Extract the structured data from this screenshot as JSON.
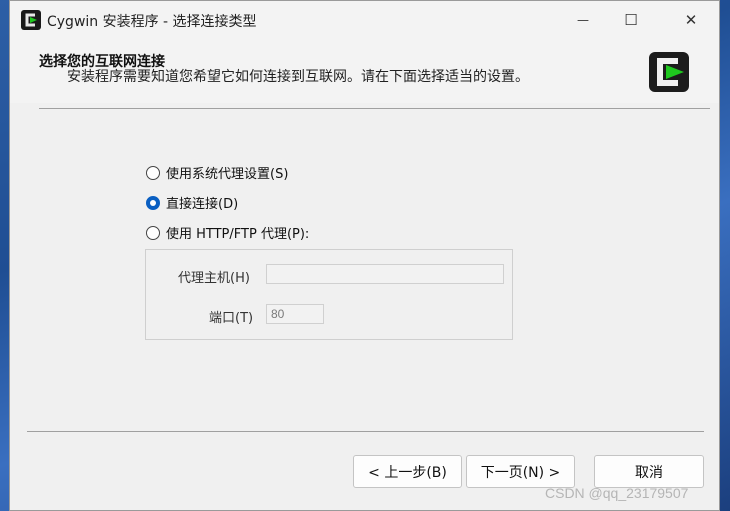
{
  "window": {
    "title": "Cygwin 安装程序 - 选择连接类型",
    "controls": {
      "minimize": "—",
      "maximize": "☐",
      "close": "✕"
    }
  },
  "header": {
    "title": "选择您的互联网连接",
    "description": "安装程序需要知道您希望它如何连接到互联网。请在下面选择适当的设置。",
    "logo_icon": "cygwin-logo-icon"
  },
  "connection_options": [
    {
      "label": "使用系统代理设置(S)",
      "checked": false
    },
    {
      "label": "直接连接(D)",
      "checked": true
    },
    {
      "label": "使用 HTTP/FTP 代理(P):",
      "checked": false
    }
  ],
  "proxy": {
    "host_label": "代理主机(H)",
    "host_value": "",
    "port_label": "端口(T)",
    "port_value": "80"
  },
  "buttons": {
    "back": "< 上一步(B)",
    "next": "下一页(N) >",
    "cancel": "取消"
  },
  "watermark": "CSDN @qq_23179507",
  "colors": {
    "accent": "#0a5fc2",
    "logo_green": "#1ec81e"
  }
}
